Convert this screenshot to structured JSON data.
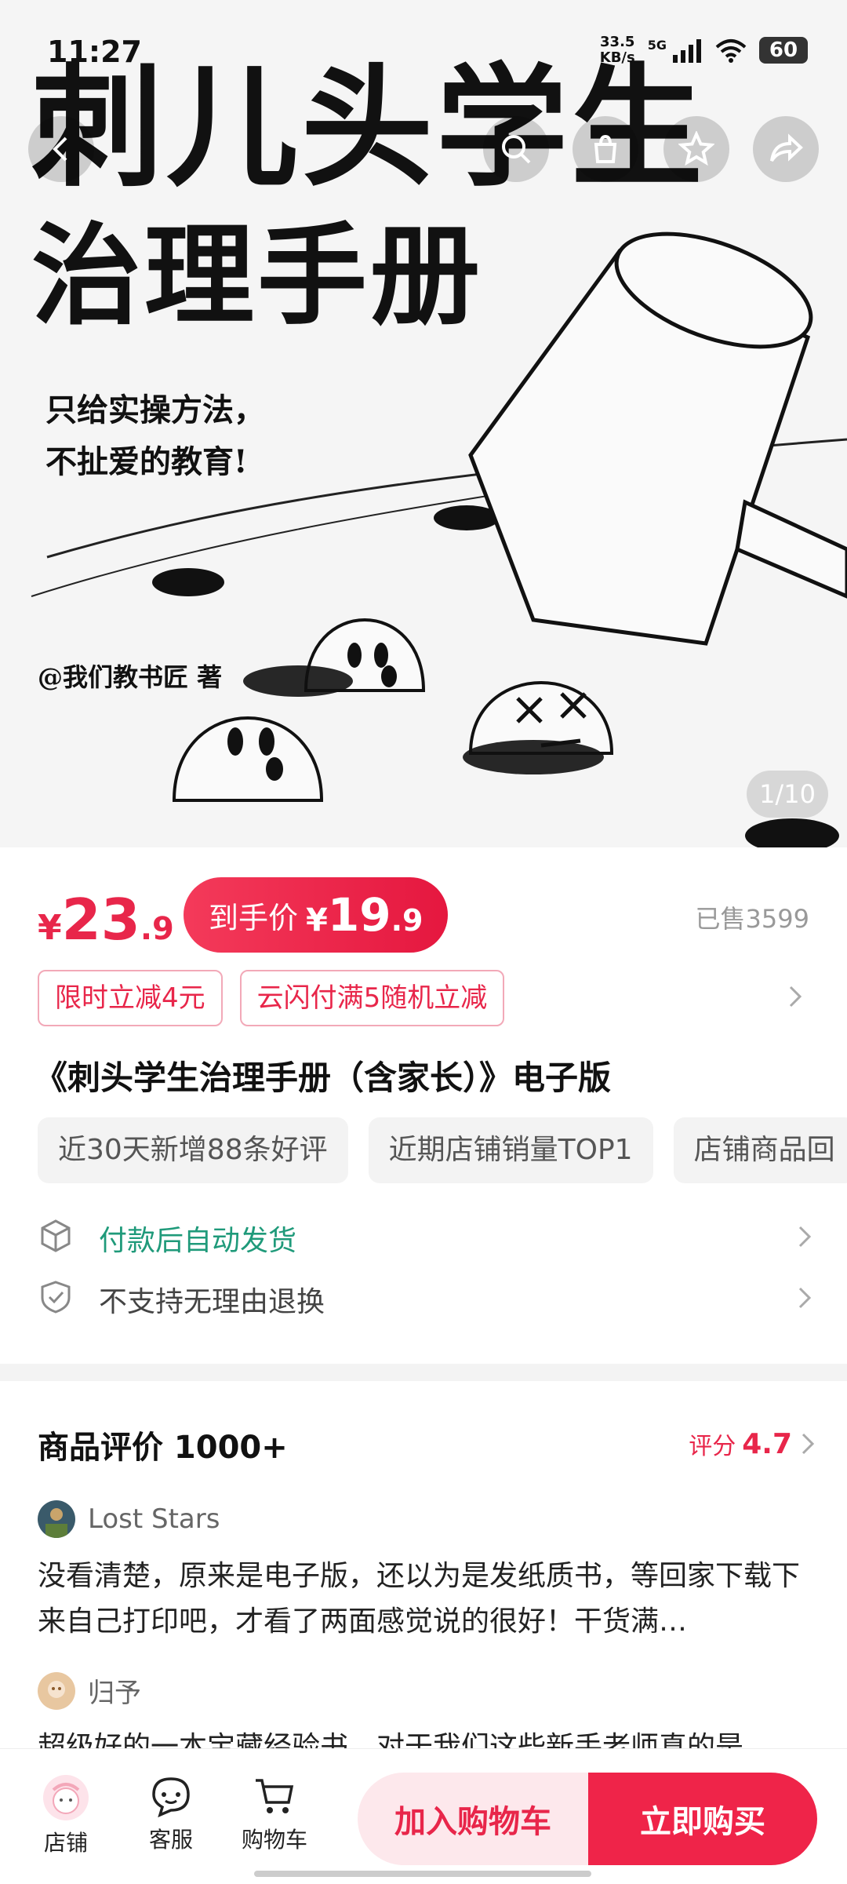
{
  "status_bar": {
    "time": "11:27",
    "net_speed_value": "33.5",
    "net_speed_unit": "KB/s",
    "network": "5G",
    "battery": "60"
  },
  "hero": {
    "title_line1": "刺儿头学生",
    "title_line2": "治理手册",
    "subtitle_line1": "只给实操方法，",
    "subtitle_line2": "不扯爱的教育!",
    "author": "@我们教书匠 著",
    "page_indicator": "1/10"
  },
  "top_buttons": [
    "back-icon",
    "search-icon",
    "store-icon",
    "star-icon",
    "share-icon"
  ],
  "price": {
    "currency": "¥",
    "integer": "23",
    "decimal": ".9",
    "final_label": "到手价",
    "final_currency": "¥",
    "final_integer": "19",
    "final_decimal": ".9",
    "sold": "已售3599"
  },
  "coupons": [
    "限时立减4元",
    "云闪付满5随机立减"
  ],
  "product_title": "《刺头学生治理手册（含家长）》电子版",
  "tags": [
    "近30天新增88条好评",
    "近期店铺销量TOP1",
    "店铺商品回"
  ],
  "services": [
    {
      "text": "付款后自动发货",
      "color": "#1f9a7a"
    },
    {
      "text": "不支持无理由退换",
      "color": "#444444"
    }
  ],
  "reviews": {
    "title": "商品评价 1000+",
    "rating_label": "评分",
    "rating_value": "4.7",
    "items": [
      {
        "name": "Lost Stars",
        "text": "没看清楚，原来是电子版，还以为是发纸质书，等回家下载下来自己打印吧，才看了两面感觉说的很好！干货满…"
      },
      {
        "name": "归予",
        "text": "超级好的一本宝藏经验书，对于我们这些新手老师真的是"
      }
    ]
  },
  "bottom_bar": {
    "shop_label": "店铺",
    "service_label": "客服",
    "cart_label": "购物车",
    "add_cart": "加入购物车",
    "buy_now": "立即购买"
  },
  "colors": {
    "accent": "#e8264a",
    "service_green": "#1f9a7a"
  }
}
